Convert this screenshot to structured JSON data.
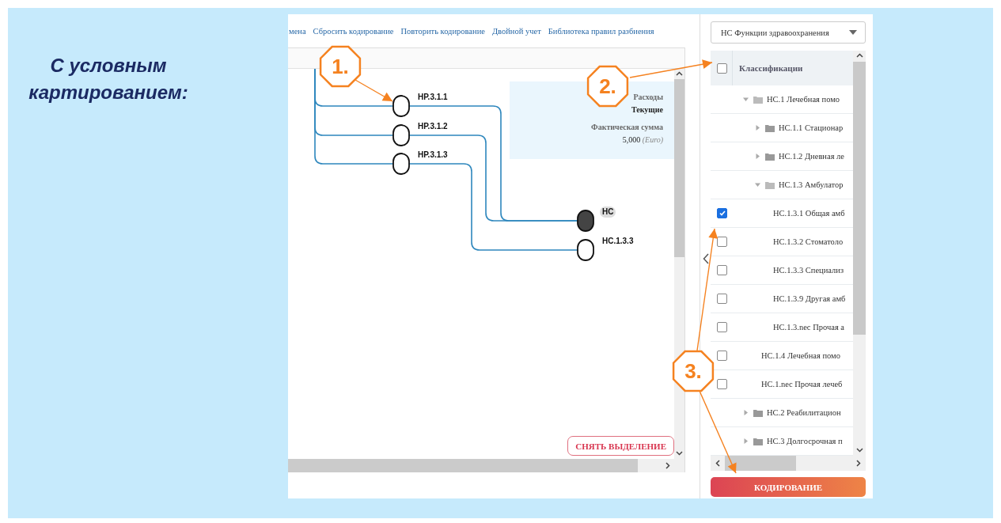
{
  "slide_title": "С условным картированием:",
  "toolbar": {
    "links": [
      "мена",
      "Сбросить кодирование",
      "Повторить кодирование",
      "Двойной учет",
      "Библиотека правил разбиения"
    ]
  },
  "diagram": {
    "nodes": [
      {
        "label": "HP.3.1.1",
        "selected": false
      },
      {
        "label": "HP.3.1.2",
        "selected": false
      },
      {
        "label": "HP.3.1.3",
        "selected": false
      },
      {
        "label": "HC",
        "selected": true
      },
      {
        "label": "HC.1.3.3",
        "selected": false
      }
    ],
    "info": {
      "label_1": "Расходы",
      "value_1": "Текущие",
      "label_2": "Фактическая сумма",
      "amount": "5,000 *(Euro)*"
    },
    "clear_button": "СНЯТЬ ВЫДЕЛЕНИЕ"
  },
  "classification_panel": {
    "dropdown": "HC Функции здравоохранения",
    "header": "Классификации",
    "header_checked": false,
    "tree": [
      {
        "label": "HC.1 Лечебная помо",
        "kind": "folder",
        "expanded": true,
        "children": [
          {
            "label": "HC.1.1 Стационар",
            "kind": "folder",
            "expanded": false
          },
          {
            "label": "HC.1.2 Дневная ле",
            "kind": "folder",
            "expanded": false
          },
          {
            "label": "HC.1.3 Амбулатор",
            "kind": "folder",
            "expanded": true,
            "children": [
              {
                "label": "HC.1.3.1 Общая амб",
                "kind": "leaf",
                "checked": true
              },
              {
                "label": "HC.1.3.2 Стоматоло",
                "kind": "leaf",
                "checked": false
              },
              {
                "label": "HC.1.3.3 Специализ",
                "kind": "leaf",
                "checked": false
              },
              {
                "label": "HC.1.3.9 Другая амб",
                "kind": "leaf",
                "checked": false
              },
              {
                "label": "HC.1.3.nec Прочая а",
                "kind": "leaf",
                "checked": false
              }
            ]
          },
          {
            "label": "HC.1.4 Лечебная помо",
            "kind": "leaf",
            "checked": false
          },
          {
            "label": "HC.1.nec Прочая лечеб",
            "kind": "leaf",
            "checked": false
          }
        ]
      },
      {
        "label": "HC.2 Реабилитацион",
        "kind": "folder",
        "expanded": false
      },
      {
        "label": "HC.3 Долгосрочная п",
        "kind": "folder",
        "expanded": false
      }
    ],
    "code_button": "КОДИРОВАНИЕ"
  },
  "annotations": [
    "1.",
    "2.",
    "3."
  ]
}
